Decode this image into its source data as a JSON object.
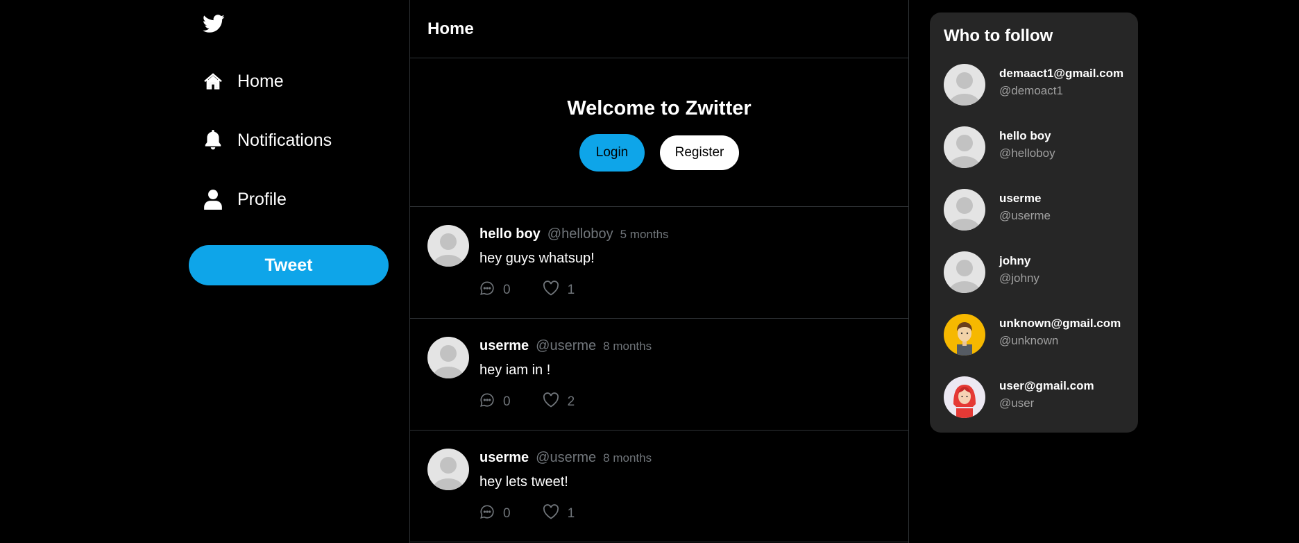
{
  "sidebar": {
    "logo_icon": "twitter-bird-icon",
    "items": [
      {
        "label": "Home",
        "icon": "home-icon"
      },
      {
        "label": "Notifications",
        "icon": "bell-icon"
      },
      {
        "label": "Profile",
        "icon": "user-icon"
      }
    ],
    "tweet_button": "Tweet"
  },
  "main": {
    "title": "Home",
    "welcome": {
      "heading": "Welcome to Zwitter",
      "login_label": "Login",
      "register_label": "Register"
    },
    "tweets": [
      {
        "name": "hello boy",
        "handle": "@helloboy",
        "time": "5 months",
        "text": "hey guys whatsup!",
        "replies": "0",
        "likes": "1"
      },
      {
        "name": "userme",
        "handle": "@userme",
        "time": "8 months",
        "text": "hey iam in !",
        "replies": "0",
        "likes": "2"
      },
      {
        "name": "userme",
        "handle": "@userme",
        "time": "8 months",
        "text": "hey lets tweet!",
        "replies": "0",
        "likes": "1"
      }
    ]
  },
  "who_to_follow": {
    "title": "Who to follow",
    "users": [
      {
        "name": "demaact1@gmail.com",
        "handle": "@demoact1",
        "avatar": "default"
      },
      {
        "name": "hello boy",
        "handle": "@helloboy",
        "avatar": "default"
      },
      {
        "name": "userme",
        "handle": "@userme",
        "avatar": "default"
      },
      {
        "name": "johny",
        "handle": "@johny",
        "avatar": "default"
      },
      {
        "name": "unknown@gmail.com",
        "handle": "@unknown",
        "avatar": "male-cartoon"
      },
      {
        "name": "user@gmail.com",
        "handle": "@user",
        "avatar": "female-cartoon"
      }
    ]
  },
  "colors": {
    "accent": "#0ea5e9",
    "background": "#000000",
    "panel": "#262626",
    "muted": "#71767b"
  }
}
